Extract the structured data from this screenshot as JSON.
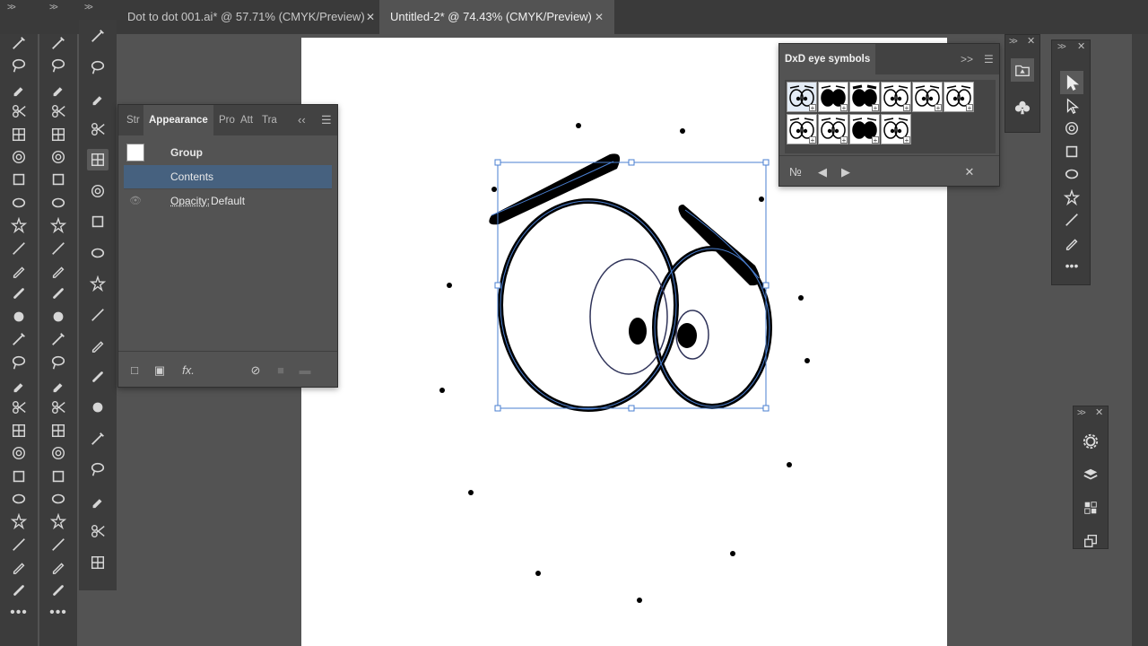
{
  "tabs": [
    {
      "label": "Dot to dot 001.ai* @ 57.71% (CMYK/Preview)",
      "close": "✕"
    },
    {
      "label": "Untitled-2* @ 74.43% (CMYK/Preview)",
      "close": "✕"
    }
  ],
  "appearance_panel": {
    "tabs": [
      "Str",
      "Appearance",
      "Pro",
      "Att",
      "Tra"
    ],
    "rows": {
      "group": "Group",
      "contents": "Contents",
      "opacity_label": "Opacity:",
      "opacity_value": "Default"
    },
    "footer_fx": "fx."
  },
  "symbols_panel": {
    "title": "DxD eye symbols",
    "symbol_count": 10,
    "selected_index": 0
  },
  "colors": {
    "selection": "#4a7fd1",
    "panel_highlight": "#46617f",
    "ui_dark": "#3c3c3c",
    "artboard": "#ffffff"
  },
  "left_tools_col1": [
    "magic-wand-icon",
    "lasso-icon",
    "eyedropper-icon",
    "scissors-icon",
    "mesh-icon",
    "spiral-icon",
    "eyedropper-alt-icon",
    "gradient-icon",
    "shape-builder-icon",
    "puppet-warp-icon",
    "free-transform-icon",
    "zoom-icon",
    "hand-icon",
    "pin-icon",
    "width-icon",
    "column-graph-icon",
    "blob-brush-icon",
    "warp-icon",
    "bloat-icon",
    "scallop-icon",
    "crystallize-icon",
    "eraser-alt-icon",
    "type-icon",
    "symbol-sprayer-icon",
    "artboard-icon",
    "more-icon"
  ],
  "left_tools_col2": [
    "pen-icon",
    "curvature-icon",
    "line-segment-icon",
    "rectangle-icon",
    "rounded-rectangle-icon",
    "ellipse-icon",
    "polygon-icon",
    "star-icon",
    "line-icon",
    "pencil-icon",
    "paintbrush-icon",
    "blob-brush-alt-icon",
    "eraser-icon",
    "rotate-icon",
    "reflect-icon",
    "scale-icon",
    "shear-icon",
    "reshape-icon",
    "warp-alt-icon",
    "twirl-icon",
    "pucker-icon",
    "bloat-alt-icon",
    "crystallize-alt-icon",
    "wrinkle-icon",
    "symbol-shifter-icon",
    "more-icon"
  ],
  "left_tools_col3": [
    "color-guide-icon",
    "gradient-panel-icon",
    "recolor-icon",
    "menu-icon",
    "appearance-toggle-icon",
    "3d-cube-icon",
    "transform-icon",
    "graphic-styles-icon",
    "puppet-icon",
    "pathfinder-icon",
    "navigator-icon",
    "play-icon",
    "align-icon",
    "info-icon",
    "distribute-icon",
    "layers-alt-icon",
    "export-icon",
    "artboards-icon"
  ],
  "right_tools": [
    "selection-arrow-icon",
    "direct-selection-icon",
    "add-anchor-icon",
    "lasso-alt-icon",
    "pencil-alt-icon",
    "swap-colors-icon",
    "fill-stroke-icon",
    "color-mode-icon",
    "more-icon"
  ],
  "right_dock2": [
    "gear-icon",
    "layers-icon",
    "swatch-icon",
    "artboard-nav-icon"
  ],
  "symbol_library_buttons": [
    "symbol-library-icon",
    "club-icon"
  ]
}
